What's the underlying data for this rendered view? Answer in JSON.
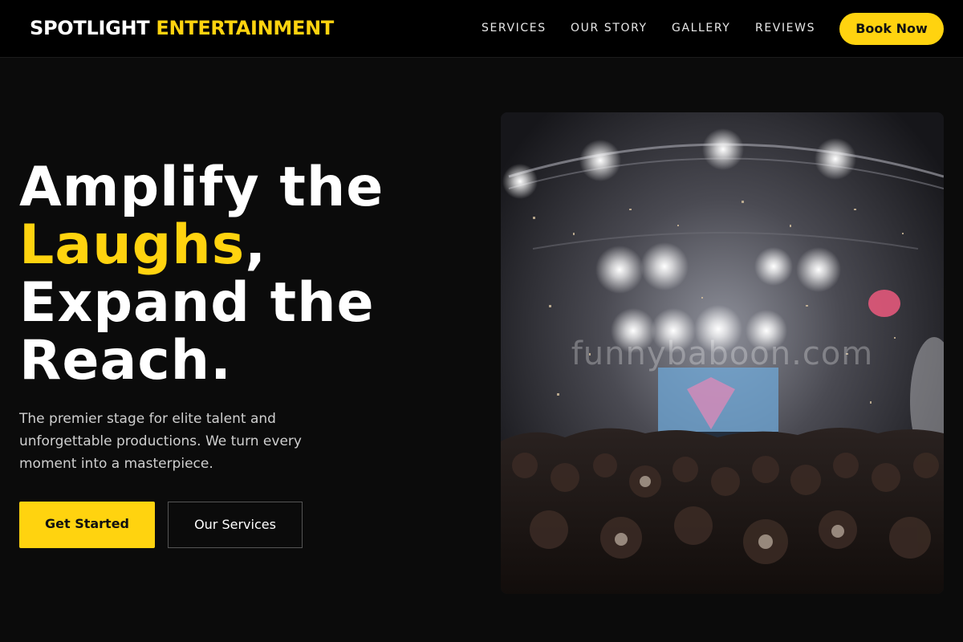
{
  "header": {
    "brand_part1": "SPOTLIGHT",
    "brand_part2": "ENTERTAINMENT",
    "nav": [
      {
        "label": "SERVICES"
      },
      {
        "label": "OUR STORY"
      },
      {
        "label": "GALLERY"
      },
      {
        "label": "REVIEWS"
      }
    ],
    "cta_label": "Book Now"
  },
  "hero": {
    "headline_line1": "Amplify the",
    "headline_highlight": "Laughs",
    "headline_comma": ",",
    "headline_line3": "Expand the",
    "headline_line4": "Reach.",
    "subtext": "The premier stage for elite talent and unforgettable productions. We turn every moment into a masterpiece.",
    "primary_button": "Get Started",
    "secondary_button": "Our Services"
  },
  "image": {
    "watermark": "funnybaboon.com"
  },
  "colors": {
    "accent": "#ffd30f",
    "background": "#0b0b0b",
    "header_bg": "#000000"
  }
}
